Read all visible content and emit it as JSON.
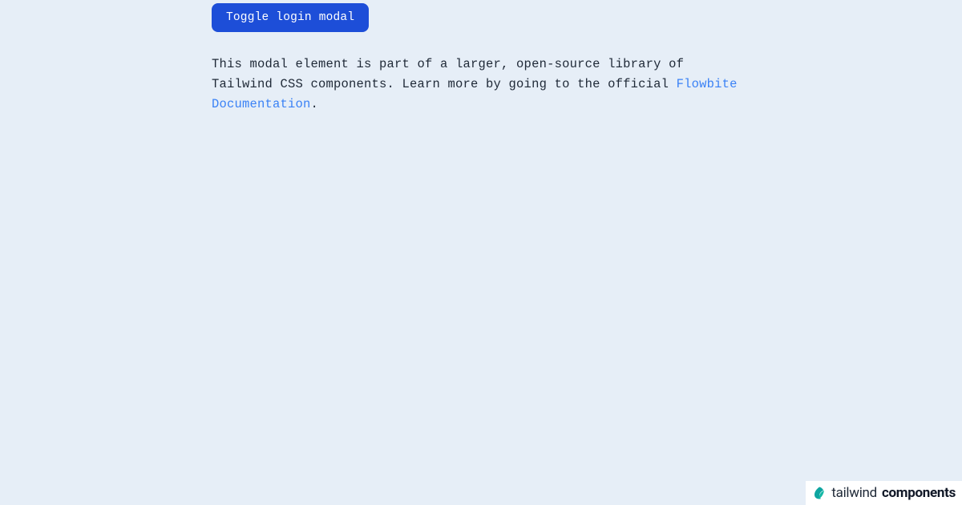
{
  "main": {
    "toggle_button_label": "Toggle login modal",
    "description_pre": "This modal element is part of a larger, open-source library of Tailwind CSS components. Learn more by going to the official ",
    "link_text": "Flowbite Documentation",
    "description_post": "."
  },
  "footer": {
    "brand_prefix": "tailwind",
    "brand_suffix": "components"
  }
}
